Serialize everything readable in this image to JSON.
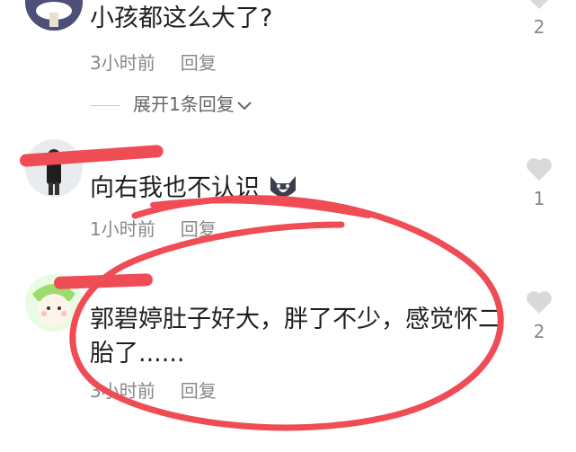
{
  "comments": [
    {
      "text": "小孩都这么大了?",
      "time": "3小时前",
      "reply_label": "回复",
      "likes": "2",
      "avatar_icon": "mushroom-avatar-icon"
    },
    {
      "text": "向右我也不认识",
      "time": "1小时前",
      "reply_label": "回复",
      "likes": "1",
      "emoji_icon": "husky-emoji-icon",
      "avatar_icon": "person-photo-avatar-icon"
    },
    {
      "text_line1": "郭碧婷肚子好大，胖了不少，感觉怀二",
      "text_line2": "胎了......",
      "time": "3小时前",
      "reply_label": "回复",
      "likes": "2",
      "avatar_icon": "cartoon-avatar-icon"
    }
  ],
  "expand_replies_label": "展开1条回复",
  "colors": {
    "annotation_red": "#ef4c55",
    "meta_gray": "#888888",
    "heart_gray": "#d9d9d9"
  }
}
